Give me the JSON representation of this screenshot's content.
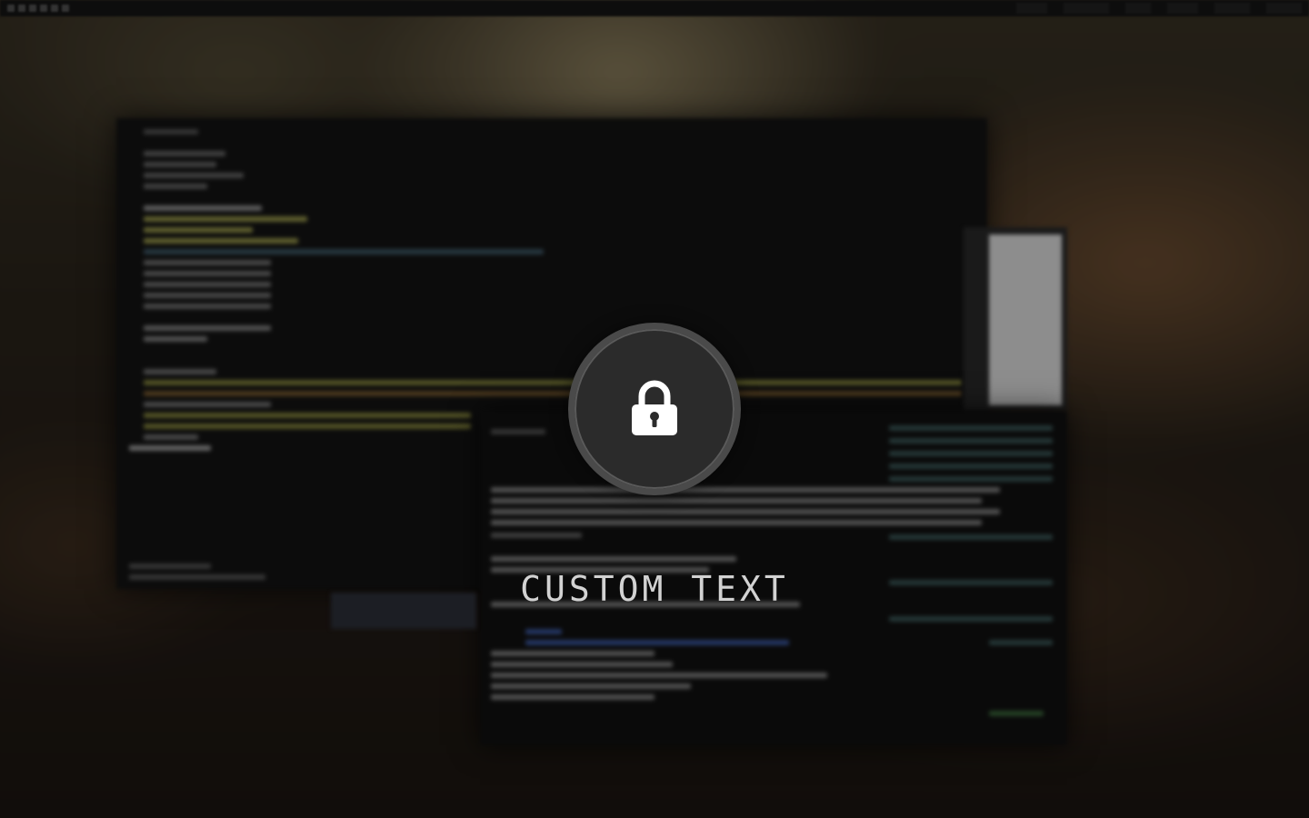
{
  "lock_screen": {
    "message": "CUSTOM TEXT",
    "icon": "lock-icon"
  },
  "colors": {
    "ring": "#4a4a4a",
    "disc": "#2b2b2b",
    "icon": "#ffffff",
    "text": "#d2d2d2"
  }
}
